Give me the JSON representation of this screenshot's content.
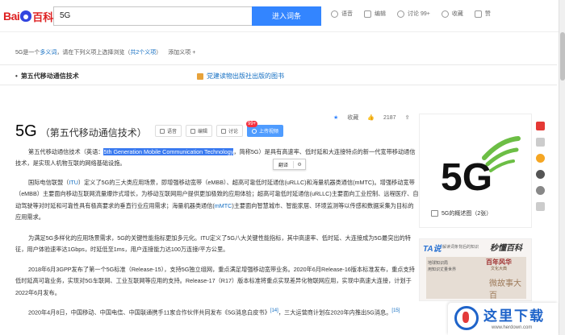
{
  "header": {
    "logo": {
      "left": "Bai",
      "right": "百科"
    },
    "search_value": "5G",
    "search_button": "进入词条",
    "tools": [
      {
        "icon": "voice-icon",
        "label": "语音"
      },
      {
        "icon": "edit-icon",
        "label": "编辑"
      },
      {
        "icon": "discuss-icon",
        "label": "讨论 99+"
      },
      {
        "icon": "favorite-icon",
        "label": "收藏"
      },
      {
        "icon": "like-icon",
        "label": "赞"
      }
    ]
  },
  "polysemy": {
    "prefix": "5G是一个",
    "link1": "多义词",
    "middle": "，请在下列义项上选择浏览（",
    "link2": "共2个义项",
    "suffix": "）",
    "add": "添加义项 +"
  },
  "senses": {
    "active": "第五代移动通信技术",
    "book": "党建读物出版社出版的图书"
  },
  "stats": {
    "favorite": "收藏",
    "likes": "2187",
    "shares": "1582"
  },
  "title": {
    "main": "5G",
    "sub": "（第五代移动通信技术）"
  },
  "actions": {
    "voice": "语音",
    "edit": "编辑",
    "discuss": "讨论",
    "discuss_badge": "99+",
    "upload": "上传视频"
  },
  "tooltip": {
    "translate": "翻译"
  },
  "paragraphs": {
    "p1_a": "第五代移动通信技术（英语：",
    "p1_hl": "5th Generation Mobile Communication Technology",
    "p1_b": "，简称5G）是具有高速率、低时延和大连接特点的新一代宽带移动通信技术，是实现人机物互联的网络基础设施。",
    "p2_a": "国际电信联盟（",
    "p2_itu": "ITU",
    "p2_b": "）定义了5G的三大类应用场景，即增强移动宽带（eMBB）、超高可靠低时延通信(uRLLC)和海量机器类通信(mMTC)。增强移动宽带（eMBB）主要面向移动互联网流量爆炸式增长，为移动互联网用户提供更加极致的应用体验；超高可靠低时延通信(uRLLC)主要面向工业控制、远程医疗、自动驾驶等对时延和可靠性具有极高要求的垂直行业应用需求；海量机器类通信(",
    "p2_mmtc": "mMTC",
    "p2_c": ")主要面向智慧城市、智能家居、环境监测等以传感和数据采集为目标的应用需求。",
    "p3": "为满足5G多样化的应用场景需求，5G的关键性能指标更加多元化。ITU定义了5G八大关键性能指标，其中高速率、低时延、大连接成为5G最突出的特征，用户体验速率达1Gbps，时延低至1ms，用户连接能力达100万连接/平方公里。",
    "p4": "2018年6月3GPP发布了第一个5G标准（Release-15），支持5G独立组网，重点满足增强移动宽带业务。2020年6月Release-16版本标准发布，重点支持低时延高可靠业务，实现对5G车联网、工业互联网等应用的支持。Release-17（R17）版本标准将重点实现差异化物联网应用，实现中高速大连接，计划于2022年6月发布。",
    "p4_ref": "[14]",
    "p5_a": "2020年4月8日，中国移动、中国电信、中国联通携手11家合作伙伴共同发布《5G消息白皮书》",
    "p5_ref1": "[14]",
    "p5_b": "，三大运营商计划在2020年内推出5G消息。",
    "p5_ref2": "[15]"
  },
  "sidebar": {
    "image_label": "5G",
    "image_caption": "5G的概述图（2张）",
    "ad": {
      "brand": "TA说",
      "tagline": "解读词条背后的知识",
      "brand2": "秒懂百科",
      "line1": "百年风华",
      "line2": "文化大典",
      "left1": "地球知识局",
      "left2": "用知识丈量世界",
      "stamp": "微故事大百"
    }
  },
  "watermark": {
    "title": "这里下载",
    "url": "www.herdown.com"
  },
  "colors": {
    "accent": "#3385ff",
    "link": "#136ec2",
    "brand_red": "#de2021",
    "highlight": "#3a7af0"
  }
}
